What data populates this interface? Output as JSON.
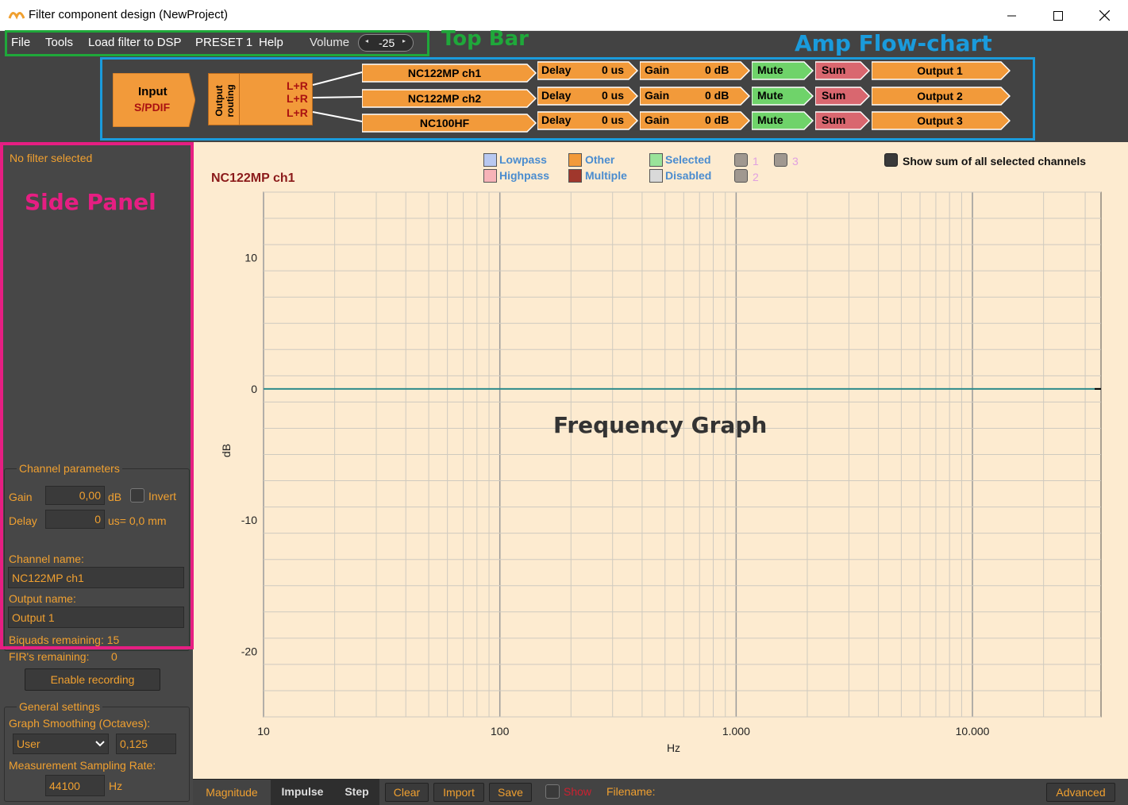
{
  "window": {
    "title": "Filter component design (NewProject)",
    "minimize_icon": "minimize-icon",
    "maximize_icon": "maximize-icon",
    "close_icon": "close-icon"
  },
  "menu": {
    "items": [
      "File",
      "Tools",
      "Load filter to DSP",
      "PRESET 1",
      "Help"
    ],
    "volume_label": "Volume",
    "volume_value": "-25"
  },
  "annotations": {
    "top_bar": "Top Bar",
    "amp_flow_chart": "Amp Flow-chart",
    "side_panel": "Side Panel",
    "frequency_graph": "Frequency Graph",
    "colors": {
      "top_bar": "#1fa83a",
      "flow_chart": "#1a9bdc",
      "side_panel": "#e61e82"
    }
  },
  "flow": {
    "input_title": "Input",
    "input_source": "S/PDIF",
    "routing_label": "Output routing",
    "routing_outputs": [
      "L+R",
      "L+R",
      "L+R"
    ],
    "channels": [
      {
        "name": "NC122MP ch1",
        "delay_label": "Delay",
        "delay_value": "0 us",
        "gain_label": "Gain",
        "gain_value": "0 dB",
        "mute_label": "Mute",
        "sum_label": "Sum",
        "output": "Output 1"
      },
      {
        "name": "NC122MP ch2",
        "delay_label": "Delay",
        "delay_value": "0 us",
        "gain_label": "Gain",
        "gain_value": "0 dB",
        "mute_label": "Mute",
        "sum_label": "Sum",
        "output": "Output 2"
      },
      {
        "name": "NC100HF",
        "delay_label": "Delay",
        "delay_value": "0 us",
        "gain_label": "Gain",
        "gain_value": "0 dB",
        "mute_label": "Mute",
        "sum_label": "Sum",
        "output": "Output 3"
      }
    ],
    "colors": {
      "orange": "#f29a3a",
      "green": "#6fd36a",
      "red": "#d9676f"
    }
  },
  "side": {
    "no_filter": "No filter selected",
    "channel_params_title": "Channel parameters",
    "gain_label": "Gain",
    "gain_value": "0,00",
    "gain_unit": "dB",
    "invert_label": "Invert",
    "delay_label": "Delay",
    "delay_value": "0",
    "delay_unit": "us= 0,0 mm",
    "channel_name_label": "Channel name:",
    "channel_name_value": "NC122MP ch1",
    "output_name_label": "Output name:",
    "output_name_value": "Output 1",
    "biquads": "Biquads remaining: 15",
    "firs_label": "FIR's remaining:",
    "firs_value": "0",
    "enable_recording": "Enable recording",
    "general_title": "General settings",
    "smoothing_label": "Graph Smoothing (Octaves):",
    "smoothing_mode": "User",
    "smoothing_value": "0,125",
    "sampling_label": "Measurement Sampling Rate:",
    "sampling_value": "44100",
    "sampling_unit": "Hz"
  },
  "legend": {
    "lowpass": "Lowpass",
    "highpass": "Highpass",
    "other": "Other",
    "multiple": "Multiple",
    "selected": "Selected",
    "disabled": "Disabled",
    "slot1": "1",
    "slot2": "2",
    "slot3": "3",
    "show_sum": "Show sum of all selected channels",
    "colors": {
      "lowpass": "#b8c8f0",
      "highpass": "#f7b3b8",
      "other": "#f29a3a",
      "multiple": "#a0372c",
      "selected": "#9ae39a",
      "disabled": "#d9d9d9",
      "slot": "#a09890"
    }
  },
  "chart_data": {
    "type": "line",
    "title": "NC122MP ch1",
    "xlabel": "Hz",
    "ylabel": "dB",
    "x_scale": "log",
    "xlim": [
      10,
      35000
    ],
    "ylim": [
      -25,
      15
    ],
    "x_ticks": [
      "10",
      "100",
      "1.000",
      "10.000"
    ],
    "y_ticks": [
      "10",
      "0",
      "-10",
      "-20"
    ],
    "grid": true,
    "series": [
      {
        "x": [
          10,
          35000
        ],
        "y": [
          0,
          0
        ],
        "color": "#2e8b8b"
      }
    ]
  },
  "bottom": {
    "tabs": [
      "Magnitude",
      "Impulse",
      "Step"
    ],
    "clear": "Clear",
    "import": "Import",
    "save": "Save",
    "show": "Show",
    "filename_label": "Filename:",
    "advanced": "Advanced"
  }
}
